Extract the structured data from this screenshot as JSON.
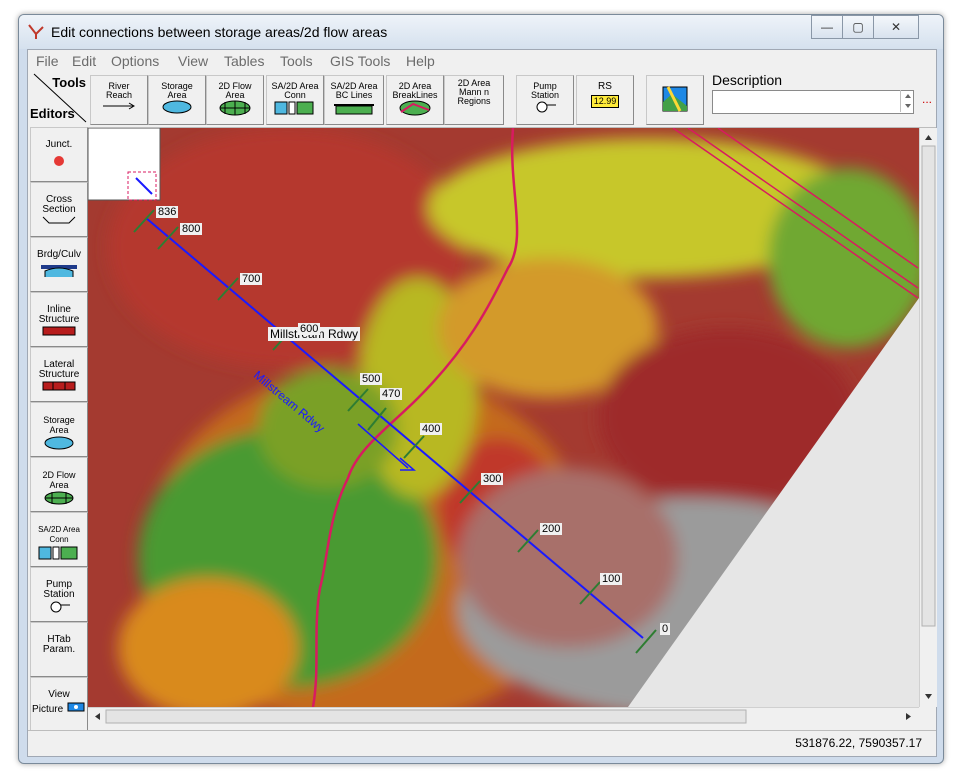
{
  "window": {
    "title": "Edit connections between storage areas/2d flow areas",
    "controls": {
      "minimize": "—",
      "maximize": "▢",
      "close": "✕"
    }
  },
  "menu": [
    "File",
    "Edit",
    "Options",
    "View",
    "Tables",
    "Tools",
    "GIS Tools",
    "Help"
  ],
  "toolbar": {
    "tools_label": "Tools",
    "editors_label": "Editors",
    "buttons": [
      {
        "line1": "River",
        "line2": "Reach"
      },
      {
        "line1": "Storage",
        "line2": "Area"
      },
      {
        "line1": "2D Flow",
        "line2": "Area"
      },
      {
        "line1": "SA/2D Area",
        "line2": "Conn"
      },
      {
        "line1": "SA/2D Area",
        "line2": "BC Lines"
      },
      {
        "line1": "2D Area",
        "line2": "BreakLines"
      },
      {
        "line1": "2D Area",
        "line2": "Mann n",
        "line3": "Regions"
      },
      {
        "line1": "Pump",
        "line2": "Station"
      },
      {
        "line1": "RS",
        "line2": "12.99"
      }
    ],
    "description_label": "Description",
    "description_value": "",
    "more_button": "..."
  },
  "editors": [
    {
      "line1": "Junct.",
      "line2": ""
    },
    {
      "line1": "Cross",
      "line2": "Section"
    },
    {
      "line1": "Brdg/Culv",
      "line2": ""
    },
    {
      "line1": "Inline",
      "line2": "Structure"
    },
    {
      "line1": "Lateral",
      "line2": "Structure"
    },
    {
      "line1": "Storage",
      "line2": "Area"
    },
    {
      "line1": "2D Flow",
      "line2": "Area"
    },
    {
      "line1": "SA/2D Area",
      "line2": "Conn"
    },
    {
      "line1": "Pump",
      "line2": "Station"
    },
    {
      "line1": "HTab",
      "line2": "Param."
    },
    {
      "line1": "View",
      "line2": "Picture"
    }
  ],
  "map": {
    "river_label": "Millstream Rdwy",
    "reach_label": "Millstream Rdwy",
    "cross_sections": [
      "836",
      "800",
      "700",
      "600",
      "500",
      "470",
      "400",
      "300",
      "200",
      "100",
      "0"
    ]
  },
  "status": {
    "coordinates": "531876.22, 7590357.17"
  }
}
